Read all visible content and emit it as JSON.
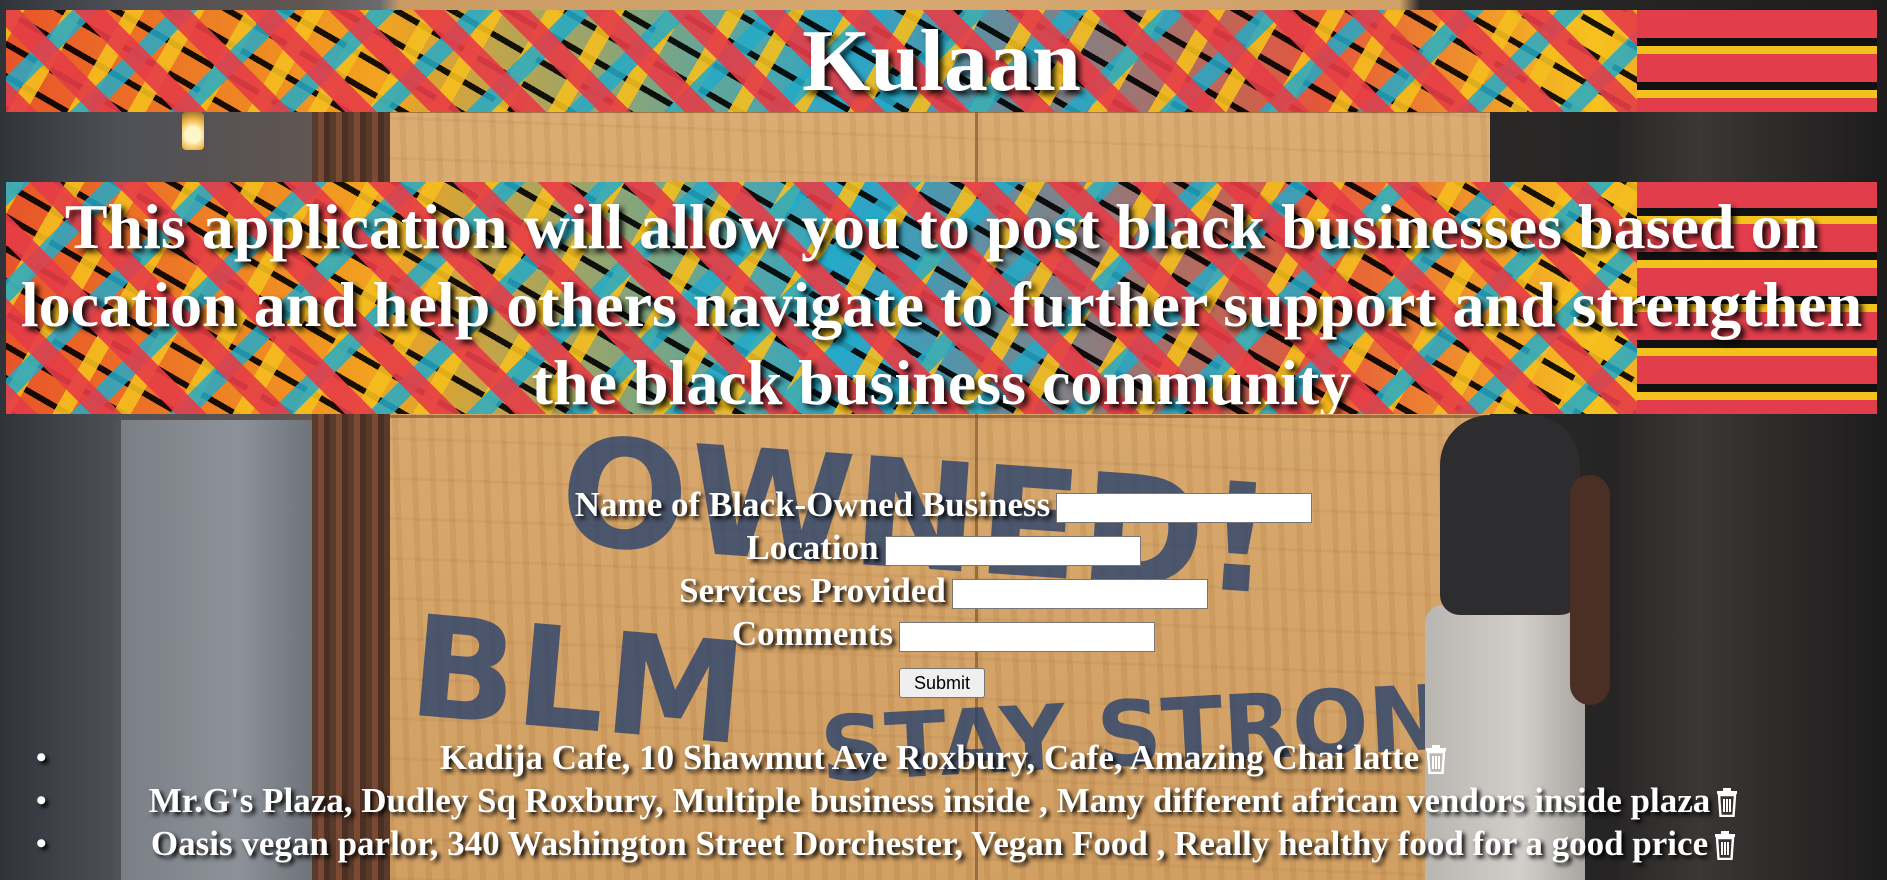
{
  "header": {
    "title": "Kulaan"
  },
  "intro": {
    "text": "This application will allow you to post black businesses based on location and help others navigate to further support and strengthen the black business community"
  },
  "form": {
    "business_label": "Name of Black-Owned Business",
    "location_label": "Location",
    "services_label": "Services Provided",
    "comments_label": "Comments",
    "business_value": "",
    "location_value": "",
    "services_value": "",
    "comments_value": "",
    "submit_label": "Submit"
  },
  "businesses": [
    {
      "text": "Kadija Cafe, 10 Shawmut Ave Roxbury, Cafe, Amazing Chai latte",
      "icon": "trash-icon"
    },
    {
      "text": "Mr.G's Plaza, Dudley Sq Roxbury, Multiple business inside , Many different african vendors inside plaza",
      "icon": "trash-icon"
    },
    {
      "text": "Oasis vegan parlor, 340 Washington Street Dorchester, Vegan Food , Really healthy food for a good price",
      "icon": "trash-icon"
    }
  ],
  "background": {
    "graffiti_line1": "OWNED!",
    "graffiti_line2": "BLM",
    "graffiti_line3": "STAY STRONG"
  },
  "colors": {
    "text": "#ffffff",
    "banner_accent": "#e23d4a"
  }
}
